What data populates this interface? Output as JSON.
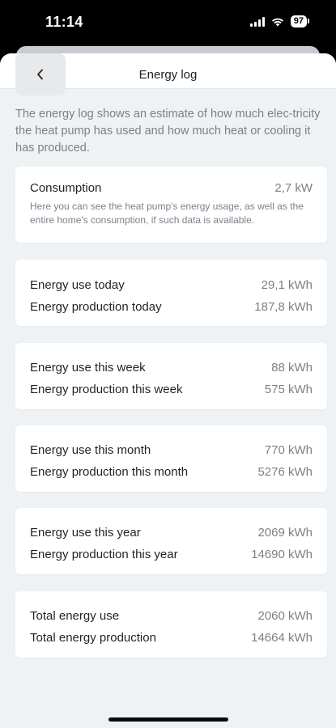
{
  "status_bar": {
    "time": "11:14",
    "battery": "97"
  },
  "nav": {
    "title": "Energy log"
  },
  "intro": "The energy log shows an estimate of how much elec-tricity the heat pump has used and how much heat or cooling it has produced.",
  "consumption": {
    "label": "Consumption",
    "value": "2,7 kW",
    "description": "Here you can see the heat pump's energy usage, as well as the entire home's consumption, if such data is available."
  },
  "cards": [
    {
      "rows": [
        {
          "label": "Energy use today",
          "value": "29,1 kWh"
        },
        {
          "label": "Energy production today",
          "value": "187,8 kWh"
        }
      ]
    },
    {
      "rows": [
        {
          "label": "Energy use this week",
          "value": "88 kWh"
        },
        {
          "label": "Energy production this week",
          "value": "575 kWh"
        }
      ]
    },
    {
      "rows": [
        {
          "label": "Energy use this month",
          "value": "770 kWh"
        },
        {
          "label": "Energy production this month",
          "value": "5276 kWh"
        }
      ]
    },
    {
      "rows": [
        {
          "label": "Energy use this year",
          "value": "2069 kWh"
        },
        {
          "label": "Energy production this year",
          "value": "14690 kWh"
        }
      ]
    },
    {
      "rows": [
        {
          "label": "Total energy use",
          "value": "2060 kWh"
        },
        {
          "label": "Total energy production",
          "value": "14664 kWh"
        }
      ]
    }
  ]
}
